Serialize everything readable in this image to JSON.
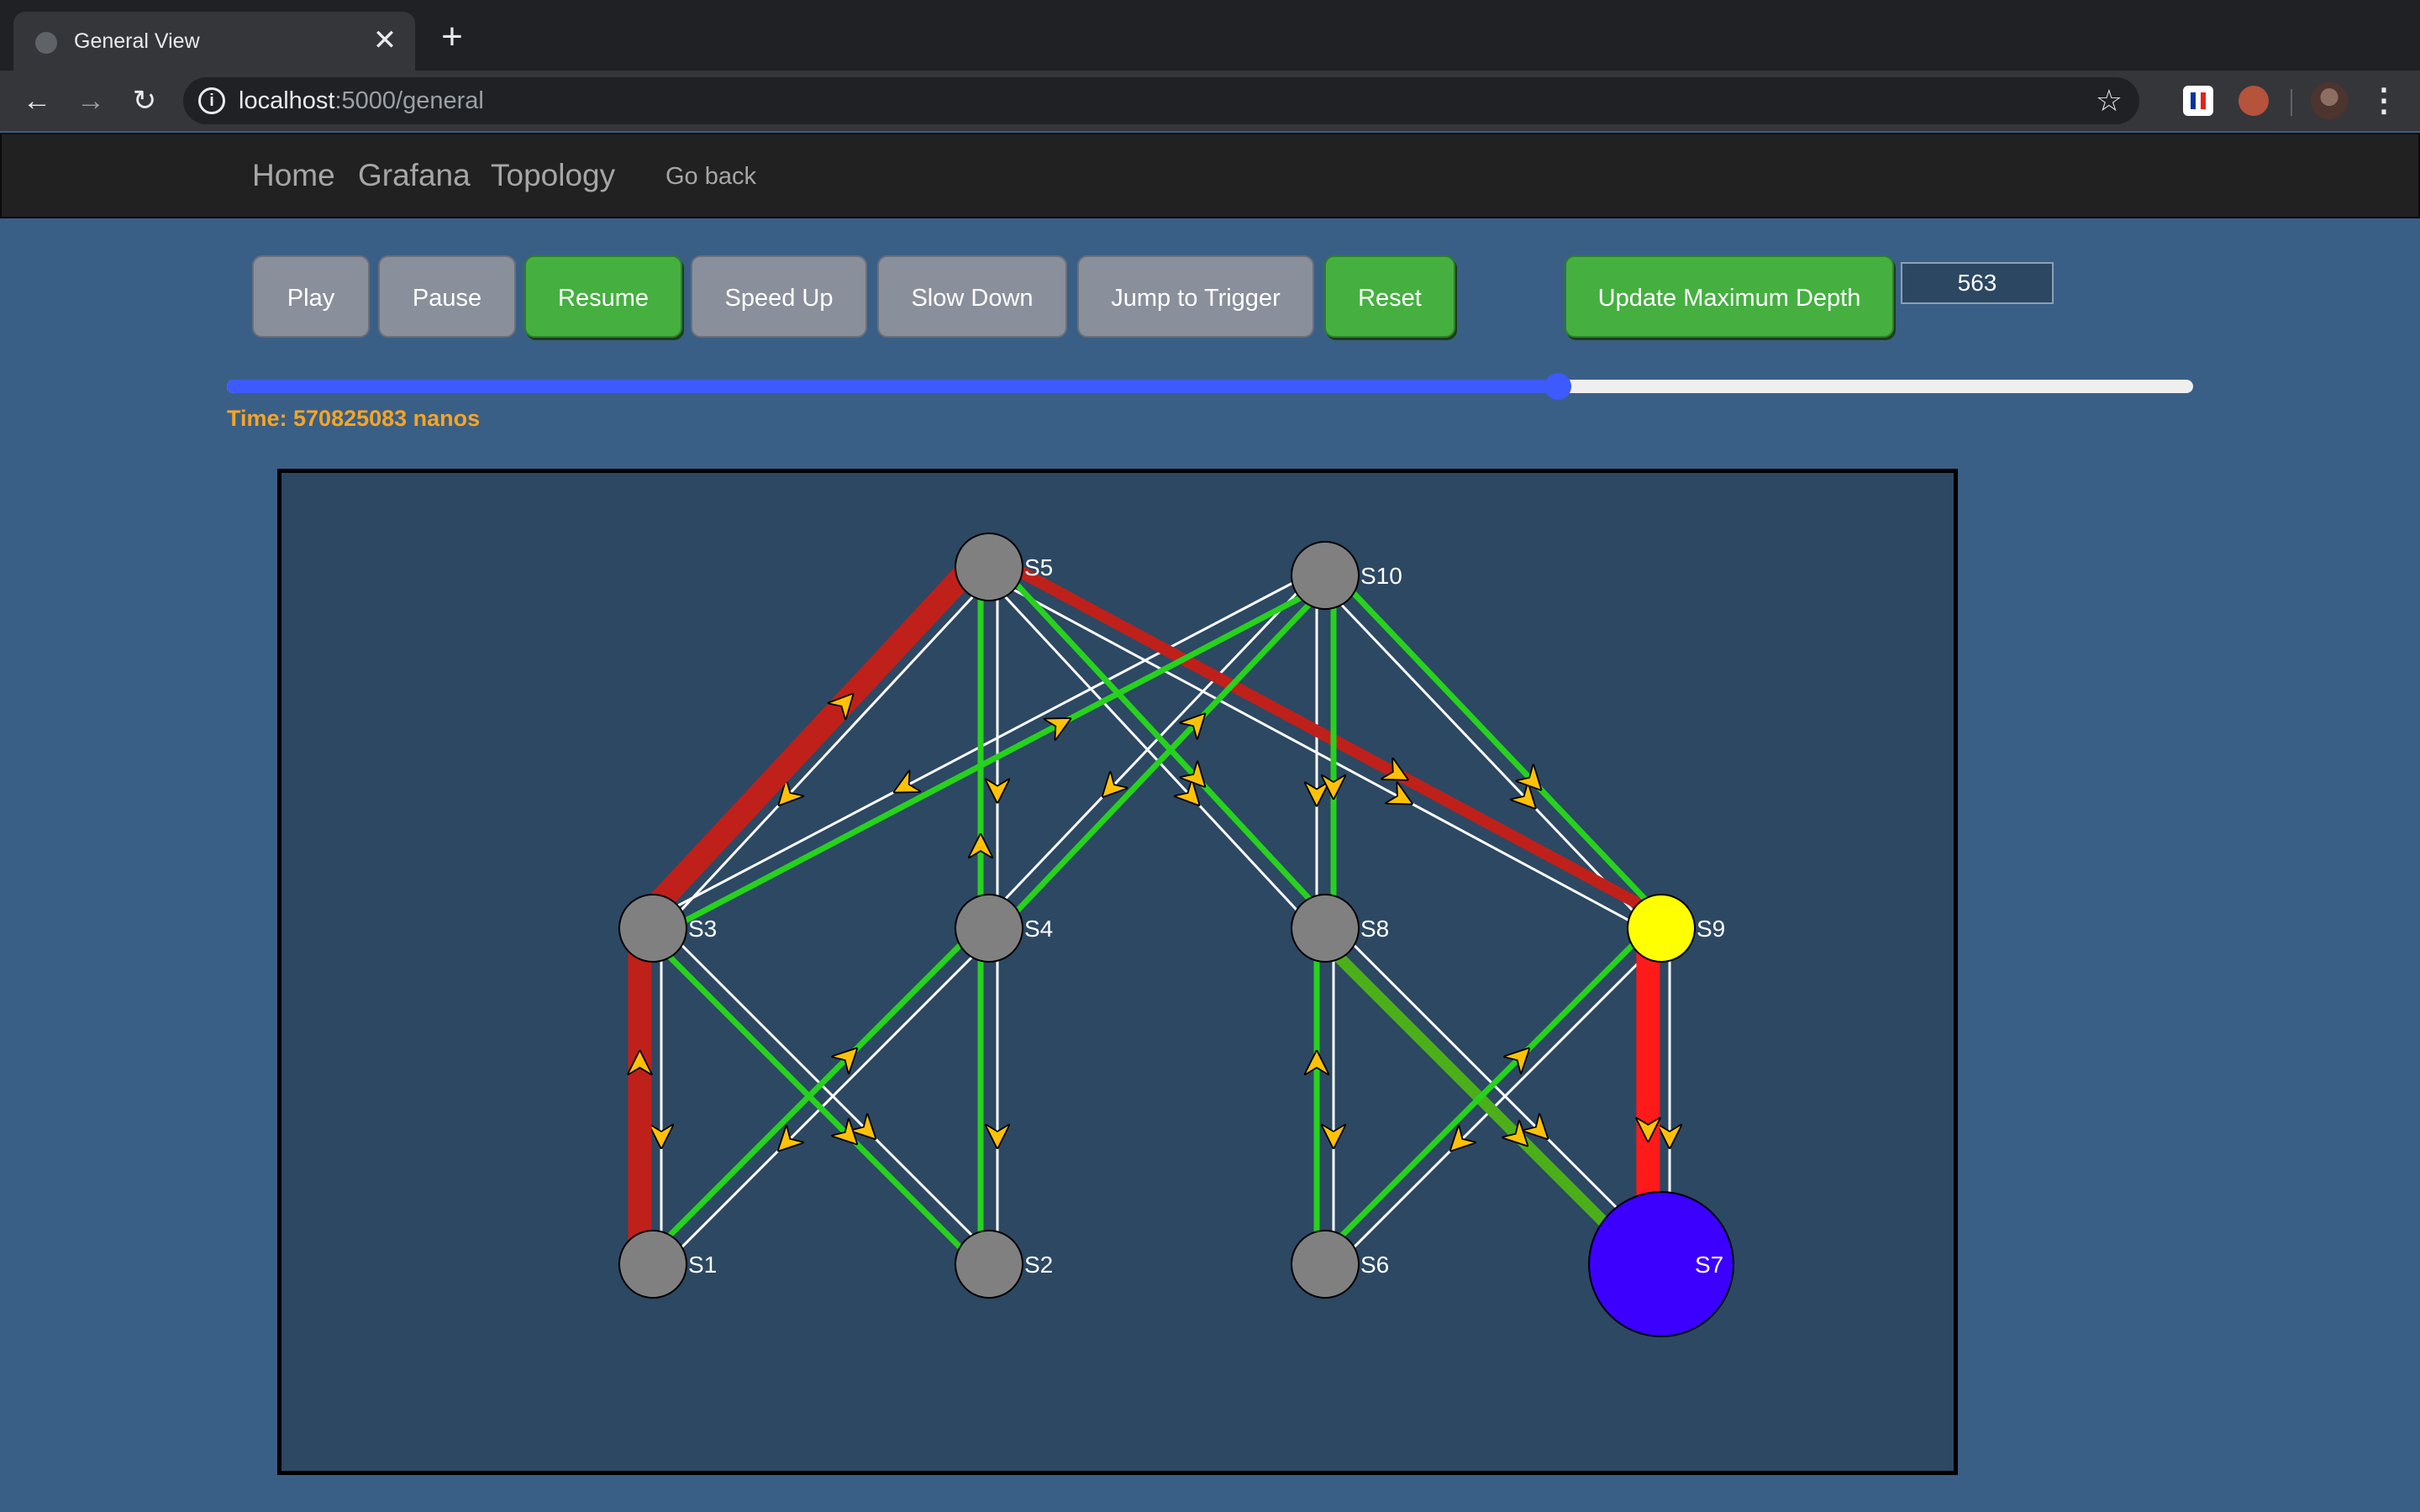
{
  "browser": {
    "tab_title": "General View",
    "tab_close": "✕",
    "new_tab": "+",
    "url_host": "localhost",
    "url_rest": ":5000/general"
  },
  "navbar": {
    "links": [
      "Home",
      "Grafana",
      "Topology"
    ],
    "go_back": "Go back"
  },
  "controls": {
    "play": "Play",
    "pause": "Pause",
    "resume": "Resume",
    "speed_up": "Speed Up",
    "slow_down": "Slow Down",
    "jump_to_trigger": "Jump to Trigger",
    "reset": "Reset",
    "update_depth": "Update Maximum Depth",
    "depth_value": "563"
  },
  "timeline": {
    "progress": 0.677,
    "time_label": "Time: 570825083 nanos"
  },
  "colors": {
    "node_default": "#808080",
    "node_trigger": "#ffff00",
    "node_active": "#3b00ff",
    "link_base": "#ffffff",
    "link_green": "#27d21d",
    "link_red": "#c0201a",
    "link_bright_red": "#ff1a1a",
    "link_olive": "#4caf1a",
    "arrow": "#ffc107",
    "slider": "#3d5afe",
    "time_text": "#f5a524"
  },
  "topology": {
    "nodes": [
      {
        "id": "S5",
        "label": "S5",
        "col": 1,
        "row": 0,
        "color": "grey"
      },
      {
        "id": "S10",
        "label": "S10",
        "col": 2,
        "row": 0,
        "color": "grey"
      },
      {
        "id": "S3",
        "label": "S3",
        "col": 0,
        "row": 1,
        "color": "grey"
      },
      {
        "id": "S4",
        "label": "S4",
        "col": 1,
        "row": 1,
        "color": "grey"
      },
      {
        "id": "S8",
        "label": "S8",
        "col": 2,
        "row": 1,
        "color": "grey"
      },
      {
        "id": "S9",
        "label": "S9",
        "col": 3,
        "row": 1,
        "color": "yellow"
      },
      {
        "id": "S1",
        "label": "S1",
        "col": 0,
        "row": 2,
        "color": "grey"
      },
      {
        "id": "S2",
        "label": "S2",
        "col": 1,
        "row": 2,
        "color": "grey"
      },
      {
        "id": "S6",
        "label": "S6",
        "col": 2,
        "row": 2,
        "color": "grey"
      },
      {
        "id": "S7",
        "label": "S7",
        "col": 3,
        "row": 2,
        "color": "blue",
        "large": true
      }
    ],
    "links": [
      {
        "from": "S5",
        "to": "S3"
      },
      {
        "from": "S5",
        "to": "S4"
      },
      {
        "from": "S5",
        "to": "S8"
      },
      {
        "from": "S5",
        "to": "S9"
      },
      {
        "from": "S10",
        "to": "S3"
      },
      {
        "from": "S10",
        "to": "S4"
      },
      {
        "from": "S10",
        "to": "S8"
      },
      {
        "from": "S10",
        "to": "S9"
      },
      {
        "from": "S3",
        "to": "S1"
      },
      {
        "from": "S3",
        "to": "S2"
      },
      {
        "from": "S4",
        "to": "S1"
      },
      {
        "from": "S4",
        "to": "S2"
      },
      {
        "from": "S8",
        "to": "S6"
      },
      {
        "from": "S8",
        "to": "S7"
      },
      {
        "from": "S9",
        "to": "S6"
      },
      {
        "from": "S9",
        "to": "S7"
      }
    ],
    "flows": [
      {
        "from": "S1",
        "to": "S3",
        "color": "red",
        "width": "thick"
      },
      {
        "from": "S3",
        "to": "S5",
        "color": "red",
        "width": "thick"
      },
      {
        "from": "S5",
        "to": "S9",
        "color": "red",
        "width": "medium"
      },
      {
        "from": "S9",
        "to": "S7",
        "color": "bright_red",
        "width": "thick"
      },
      {
        "from": "S8",
        "to": "S7",
        "color": "olive",
        "width": "medium"
      },
      {
        "from": "S3",
        "to": "S10",
        "color": "green",
        "width": "thin"
      },
      {
        "from": "S1",
        "to": "S4",
        "color": "green",
        "width": "thin"
      },
      {
        "from": "S2",
        "to": "S5",
        "color": "green",
        "width": "thin"
      },
      {
        "from": "S4",
        "to": "S10",
        "color": "green",
        "width": "thin"
      },
      {
        "from": "S5",
        "to": "S8",
        "color": "green",
        "width": "thin"
      },
      {
        "from": "S10",
        "to": "S8",
        "color": "green",
        "width": "thin"
      },
      {
        "from": "S10",
        "to": "S9",
        "color": "green",
        "width": "thin"
      },
      {
        "from": "S3",
        "to": "S2",
        "color": "green",
        "width": "thin"
      },
      {
        "from": "S6",
        "to": "S8",
        "color": "green",
        "width": "thin"
      },
      {
        "from": "S6",
        "to": "S9",
        "color": "green",
        "width": "thin"
      }
    ]
  }
}
